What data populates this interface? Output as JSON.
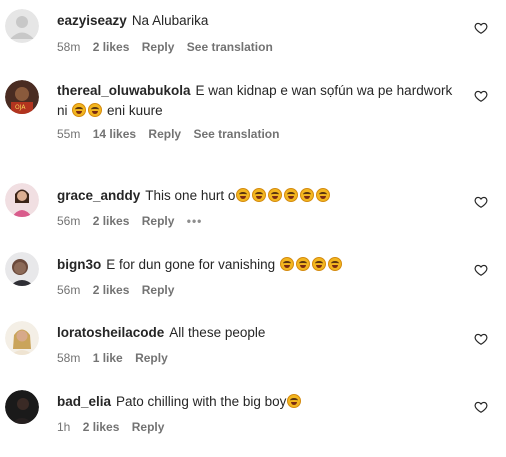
{
  "comments": [
    {
      "username": "eazyiseazy",
      "text_parts": [
        "Na Alubarika"
      ],
      "emoji_after": [
        0
      ],
      "time": "58m",
      "likes": "2 likes",
      "reply": "Reply",
      "translation": "See translation",
      "avatar": "default-avatar"
    },
    {
      "username": "thereal_oluwabukola",
      "text_parts": [
        "E wan kidnap e wan sọfún wa pe hardwork ni",
        "eni kuure"
      ],
      "emoji_count_mid": 2,
      "time": "55m",
      "likes": "14 likes",
      "reply": "Reply",
      "translation": "See translation",
      "avatar": "photo-avatar"
    },
    {
      "username": "grace_anddy",
      "text_parts": [
        "This one hurt o"
      ],
      "emoji_count_end": 6,
      "time": "56m",
      "likes": "2 likes",
      "reply": "Reply",
      "more": "•••",
      "avatar": "photo-avatar"
    },
    {
      "username": "bign3o",
      "text_parts": [
        "E for dun gone for vanishing"
      ],
      "emoji_count_end": 4,
      "time": "56m",
      "likes": "2 likes",
      "reply": "Reply",
      "avatar": "photo-avatar"
    },
    {
      "username": "loratosheilacode",
      "text_parts": [
        "All these people"
      ],
      "time": "58m",
      "likes": "1 like",
      "reply": "Reply",
      "avatar": "photo-avatar"
    },
    {
      "username": "bad_elia",
      "text_parts": [
        "Pato chilling with the big boy"
      ],
      "emoji_count_end": 1,
      "time": "1h",
      "likes": "2 likes",
      "reply": "Reply",
      "avatar": "photo-avatar"
    }
  ],
  "icons": {
    "like": "heart-outline-icon",
    "emoji": "laughing-tears-emoji"
  },
  "colors": {
    "text": "#262626",
    "meta": "#737373",
    "background": "#ffffff"
  }
}
